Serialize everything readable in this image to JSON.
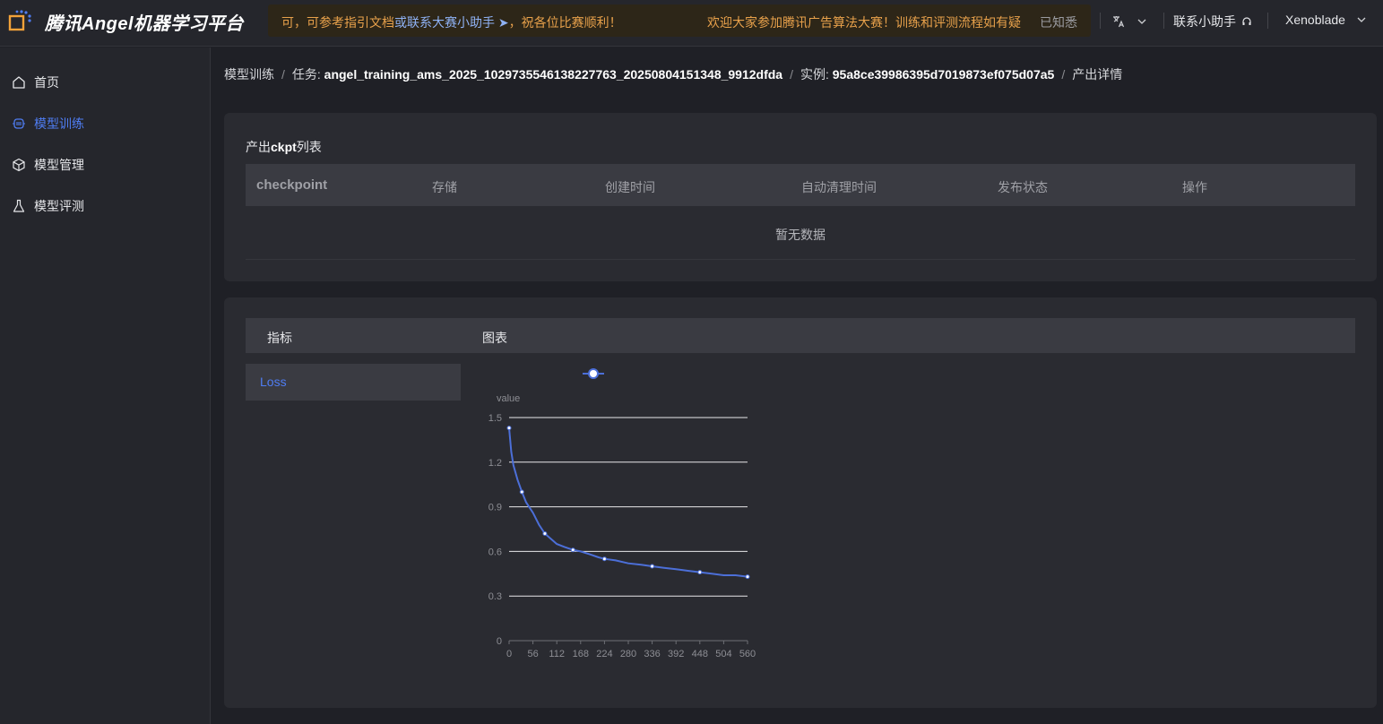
{
  "app": {
    "title": "腾讯Angel机器学习平台"
  },
  "notice": {
    "left_text_1": "可，可参考指引文档",
    "left_link": "或联系大赛小助手 ➤",
    "left_text_2": "，祝各位比赛顺利！",
    "right_text": "欢迎大家参加腾讯广告算法大赛！训练和评测流程如有疑",
    "dismiss": "已知悉"
  },
  "header": {
    "lang_icon": "translate-icon",
    "contact_label": "联系小助手",
    "user_name": "Xenoblade"
  },
  "sidebar": {
    "items": [
      {
        "label": "首页",
        "icon": "home-icon"
      },
      {
        "label": "模型训练",
        "icon": "chip-icon",
        "active": true
      },
      {
        "label": "模型管理",
        "icon": "cube-icon"
      },
      {
        "label": "模型评测",
        "icon": "flask-icon"
      }
    ]
  },
  "breadcrumb": {
    "item1": "模型训练",
    "item2_prefix": "任务: ",
    "item2_value": "angel_training_ams_2025_1029735546138227763_20250804151348_9912dfda",
    "item3_prefix": "实例: ",
    "item3_value": "95a8ce39986395d7019873ef075d07a5",
    "item4": "产出详情"
  },
  "ckpt": {
    "title_prefix": "产出",
    "title_bold": "ckpt",
    "title_suffix": "列表",
    "columns": [
      "checkpoint",
      "存储",
      "创建时间",
      "自动清理时间",
      "发布状态",
      "操作"
    ],
    "empty_text": "暂无数据"
  },
  "metrics": {
    "col_metric": "指标",
    "col_chart": "图表",
    "items": [
      "Loss"
    ]
  },
  "chart_data": {
    "type": "line",
    "ylabel": "value",
    "ylim": [
      0,
      1.5
    ],
    "yticks": [
      "0",
      "0.3",
      "0.6",
      "0.9",
      "1.2",
      "1.5"
    ],
    "xlim": [
      0,
      560
    ],
    "xticks": [
      "0",
      "56",
      "112",
      "168",
      "224",
      "280",
      "336",
      "392",
      "448",
      "504",
      "560"
    ],
    "legend_placement": "top-center",
    "grid": true,
    "series_color": "#4c6fd8",
    "series": [
      {
        "name": "",
        "x": [
          0,
          5,
          10,
          20,
          30,
          40,
          56,
          70,
          84,
          100,
          112,
          130,
          150,
          168,
          190,
          210,
          224,
          250,
          280,
          310,
          336,
          364,
          392,
          420,
          448,
          476,
          504,
          532,
          560
        ],
        "y": [
          1.43,
          1.27,
          1.18,
          1.08,
          1.0,
          0.93,
          0.86,
          0.78,
          0.72,
          0.68,
          0.65,
          0.63,
          0.61,
          0.6,
          0.58,
          0.56,
          0.55,
          0.54,
          0.52,
          0.51,
          0.5,
          0.49,
          0.48,
          0.47,
          0.46,
          0.45,
          0.44,
          0.44,
          0.43
        ]
      }
    ]
  }
}
